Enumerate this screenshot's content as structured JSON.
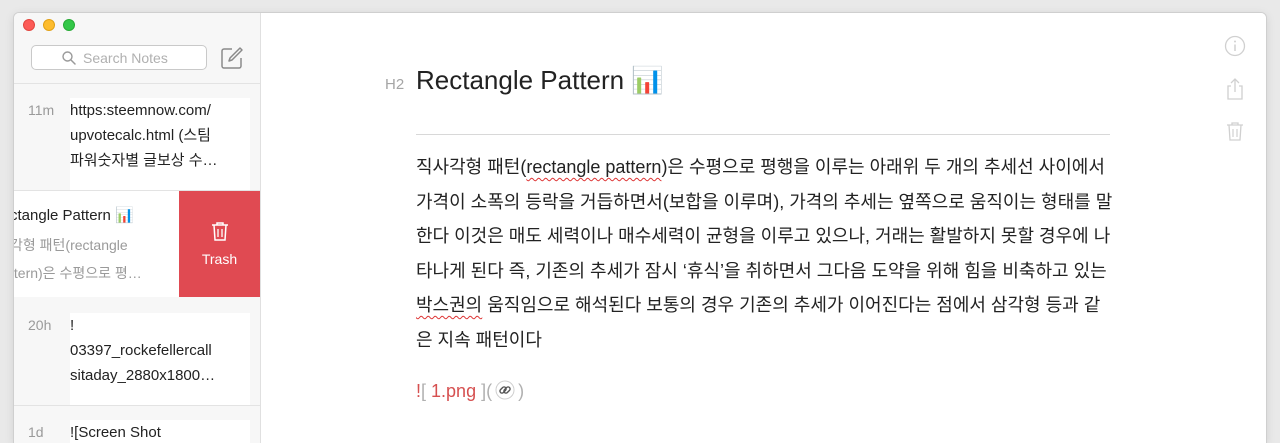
{
  "sidebar": {
    "search_placeholder": "Search Notes",
    "notes": [
      {
        "age": "11m",
        "line1": "https:steemnow.com/",
        "line2": "upvotecalc.html (스팀",
        "line3": "파워숫자별 글보상 수…"
      },
      {
        "age": "",
        "title": "ctangle Pattern 📊",
        "preview1": "각형 패턴(rectangle",
        "preview2": "ttern)은 수평으로 평…",
        "action_label": "Trash"
      },
      {
        "age": "20h",
        "line1": "!",
        "line2": "03397_rockefellercall",
        "line3": "sitaday_2880x1800…"
      },
      {
        "age": "1d",
        "line1": "![Screen Shot"
      }
    ]
  },
  "editor": {
    "heading_marker": "H2",
    "title": "Rectangle Pattern 📊",
    "paragraph": {
      "p1": "직사각형 패턴(",
      "p2": "rectangle pattern",
      "p3": ")은 수평으로 평행을 이루는 아래위 두 개의 추세선 사이에서 가격이 소폭의 등락을 거듭하면서(보합을 이루며), 가격의 추세는 옆쪽으로 움직이는 형태를 말한다 이것은 매도 세력이나 매수세력이 균형을 이루고 있으나, 거래는 활발하지 못할 경우에 나타나게 된다 즉, 기존의 추세가 잠시 ‘휴식’을 취하면서 그다음 도약을 위해 힘을 비축하고 있는 ",
      "p4": "박스권의",
      "p5": " 움직임으로 해석된다 보통의 경우 기존의 추세가 이어진다는 점에서 삼각형 등과 같은 지속 패턴이다"
    },
    "image_md": {
      "bang": "!",
      "open": "[",
      "alt": " 1.png ",
      "close": "]",
      "paren_open": "(",
      "paren_close": ")"
    }
  },
  "colors": {
    "trash": "#e04a52",
    "accent_red": "#d65050"
  },
  "icons": [
    "search-icon",
    "compose-icon",
    "trash-icon",
    "info-icon",
    "share-icon",
    "link-icon"
  ]
}
